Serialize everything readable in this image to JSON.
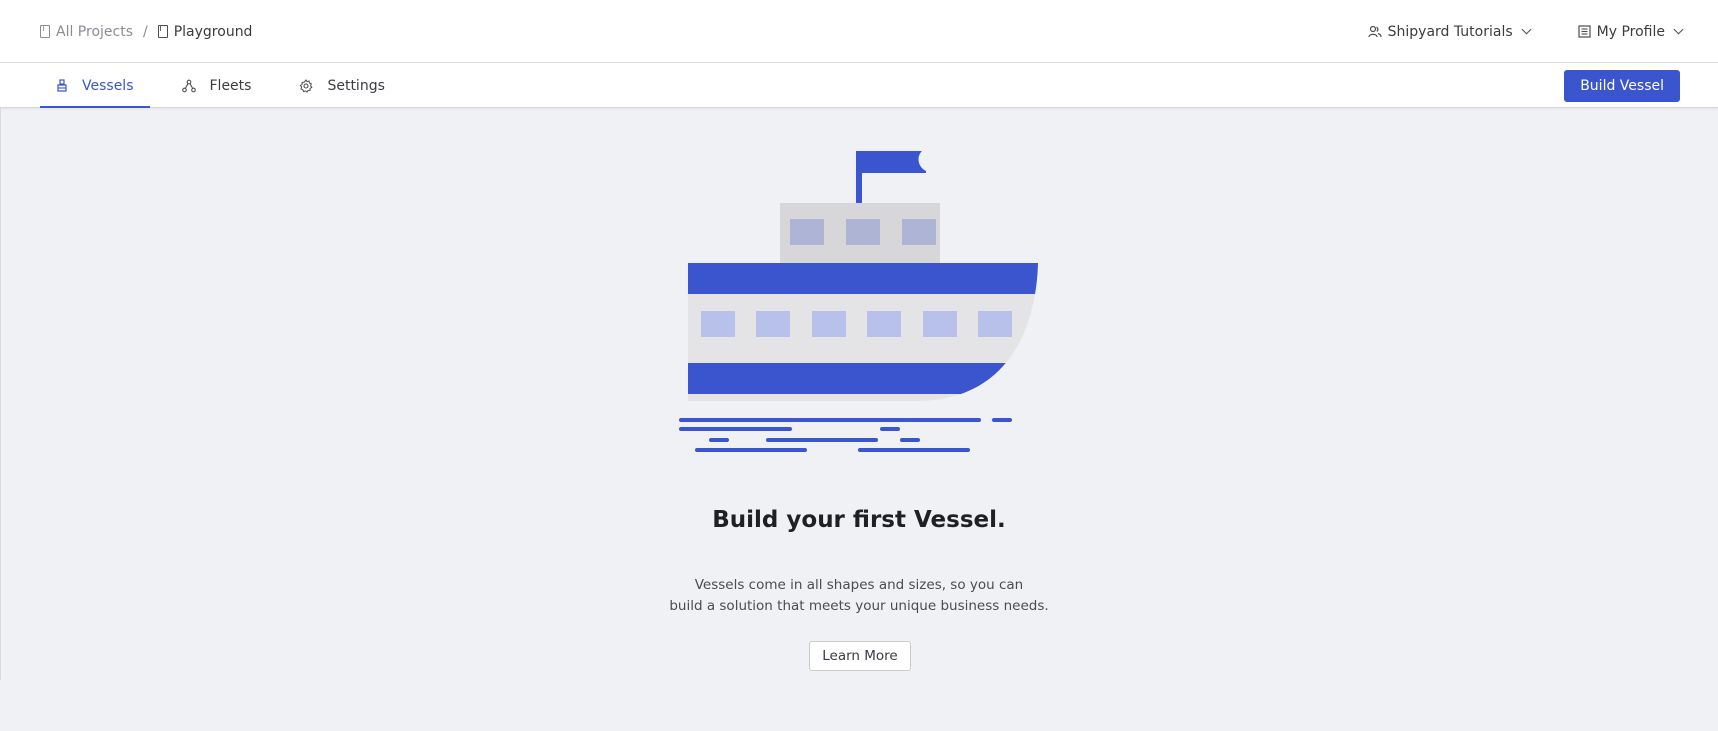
{
  "breadcrumb": {
    "root_label": "All Projects",
    "separator": "/",
    "current_label": "Playground"
  },
  "top_menu": {
    "org_label": "Shipyard Tutorials",
    "profile_label": "My Profile"
  },
  "tabs": [
    {
      "label": "Vessels",
      "icon": "vessel-icon",
      "active": true
    },
    {
      "label": "Fleets",
      "icon": "fleet-icon",
      "active": false
    },
    {
      "label": "Settings",
      "icon": "gear-icon",
      "active": false
    }
  ],
  "actions": {
    "build_vessel_label": "Build Vessel"
  },
  "empty_state": {
    "title": "Build your first Vessel.",
    "description_line1": "Vessels come in all shapes and sizes, so you can",
    "description_line2": "build a solution that meets your unique business needs.",
    "learn_more_label": "Learn More"
  },
  "colors": {
    "accent": "#3b55cf",
    "background": "#f0f1f4",
    "hull_light": "#e4e4e6",
    "window_light": "#b7c1ea",
    "cabin_gray": "#d7d7d9",
    "cabin_window": "#aeb5d4"
  }
}
